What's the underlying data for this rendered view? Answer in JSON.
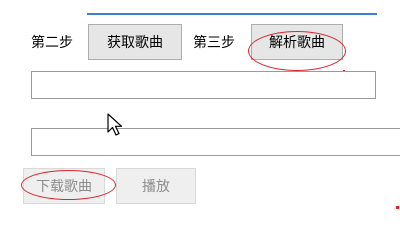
{
  "steps": {
    "step2_label": "第二步",
    "step3_label": "第三步"
  },
  "buttons": {
    "get_songs": "获取歌曲",
    "parse_songs": "解析歌曲",
    "download_songs": "下载歌曲",
    "play": "播放"
  },
  "fields": {
    "song_input_value": "",
    "parsed_output_value": ""
  },
  "colors": {
    "annotation_red": "#d9272e",
    "accent_blue": "#3c7fd0"
  },
  "icons": {
    "cursor": "arrow-cursor-icon"
  }
}
